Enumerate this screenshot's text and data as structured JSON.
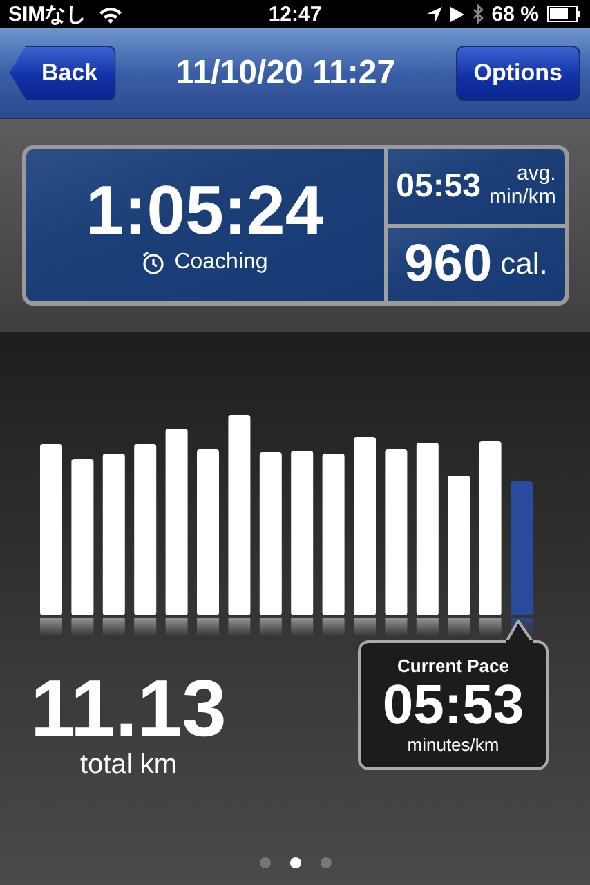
{
  "status_bar": {
    "carrier": "SIMなし",
    "time": "12:47",
    "battery": "68 %"
  },
  "nav_bar": {
    "back": "Back",
    "title": "11/10/20 11:27",
    "options": "Options"
  },
  "stats": {
    "duration": "1:05:24",
    "coaching": "Coaching",
    "avg_pace": "05:53",
    "avg_label": "avg.",
    "avg_unit": "min/km",
    "calories": "960",
    "calories_unit": "cal."
  },
  "distance": {
    "value": "11.13",
    "unit": "total km"
  },
  "current_pace": {
    "title": "Current Pace",
    "value": "05:53",
    "unit": "minutes/km"
  },
  "page_dots": [
    {
      "selected": false
    },
    {
      "selected": true
    },
    {
      "selected": false
    }
  ]
}
